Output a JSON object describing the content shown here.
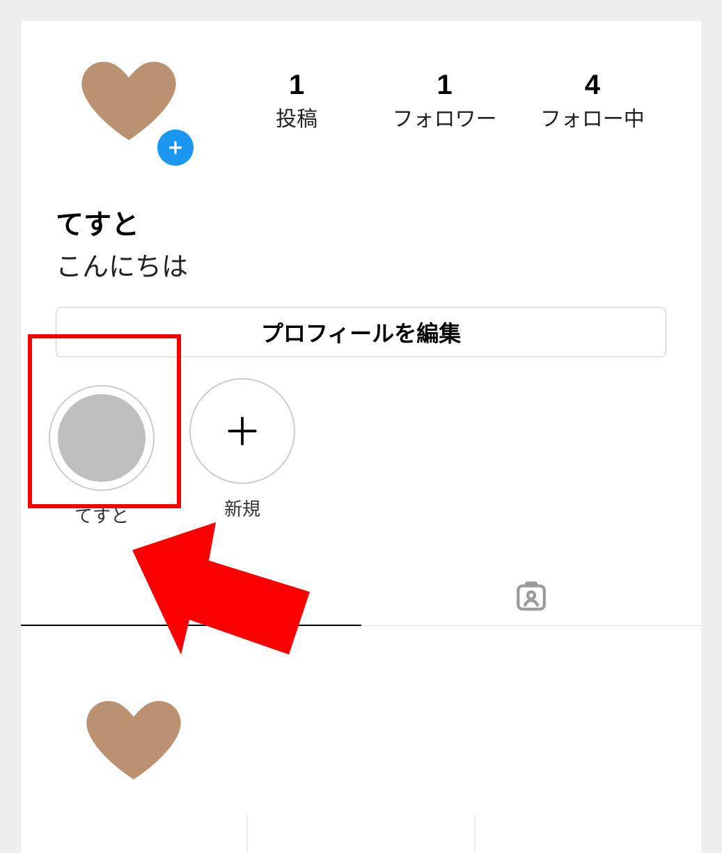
{
  "colors": {
    "heart": "#bb9271",
    "accent_blue": "#1a97f0",
    "annotation_red": "#f60000"
  },
  "profile": {
    "display_name": "てすと",
    "bio": "こんにちは"
  },
  "stats": {
    "posts": {
      "count": "1",
      "label": "投稿"
    },
    "followers": {
      "count": "1",
      "label": "フォロワー"
    },
    "following": {
      "count": "4",
      "label": "フォロー中"
    }
  },
  "edit_button_label": "プロフィールを編集",
  "highlights": [
    {
      "label": "てすと",
      "kind": "existing"
    },
    {
      "label": "新規",
      "kind": "new"
    }
  ],
  "icons": {
    "add": "plus-icon",
    "grid_tab": "grid-icon",
    "tagged_tab": "tagged-person-icon"
  }
}
